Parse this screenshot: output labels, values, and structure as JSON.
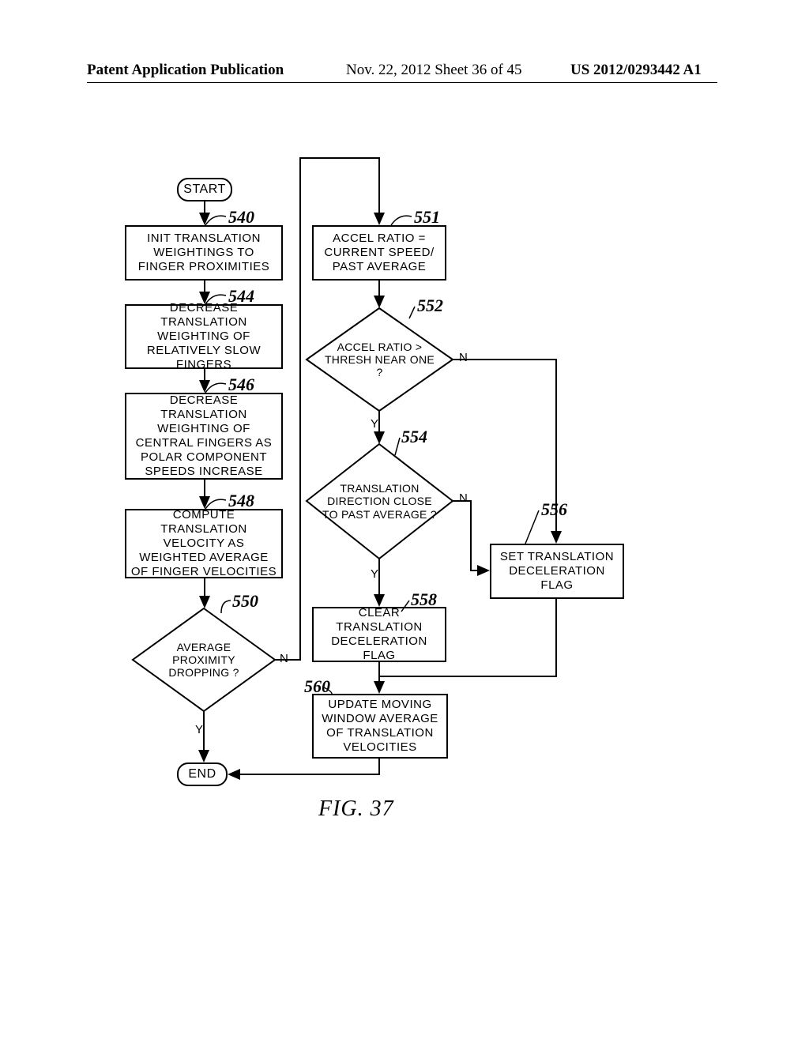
{
  "header": {
    "left": "Patent Application Publication",
    "center": "Nov. 22, 2012  Sheet 36 of 45",
    "right": "US 2012/0293442 A1"
  },
  "figure_label": "FIG.  37",
  "labels": {
    "Y": "Y",
    "N": "N"
  },
  "nodes": {
    "start": "START",
    "b540": "INIT TRANSLATION WEIGHTINGS TO FINGER PROXIMITIES",
    "b544": "DECREASE TRANSLATION WEIGHTING OF RELATIVELY SLOW FINGERS",
    "b546": "DECREASE TRANSLATION WEIGHTING OF CENTRAL FINGERS AS POLAR COMPONENT SPEEDS INCREASE",
    "b548": "COMPUTE TRANSLATION VELOCITY AS WEIGHTED AVERAGE OF FINGER VELOCITIES",
    "d550": "AVERAGE PROXIMITY DROPPING ?",
    "end": "END",
    "b551": "ACCEL RATIO = CURRENT SPEED/ PAST AVERAGE",
    "d552": "ACCEL RATIO > THRESH NEAR ONE ?",
    "d554": "TRANSLATION DIRECTION CLOSE TO PAST AVERAGE ?",
    "b556": "SET TRANSLATION DECELERATION FLAG",
    "b558": "CLEAR TRANSLATION DECELERATION FLAG",
    "b560": "UPDATE MOVING WINDOW AVERAGE OF TRANSLATION VELOCITIES"
  },
  "refs": {
    "r540": "540",
    "r544": "544",
    "r546": "546",
    "r548": "548",
    "r550": "550",
    "r551": "551",
    "r552": "552",
    "r554": "554",
    "r556": "556",
    "r558": "558",
    "r560": "560"
  },
  "chart_data": {
    "type": "flowchart",
    "title": "FIG. 37",
    "nodes": [
      {
        "id": "start",
        "type": "terminal",
        "text": "START"
      },
      {
        "id": "540",
        "type": "process",
        "text": "INIT TRANSLATION WEIGHTINGS TO FINGER PROXIMITIES"
      },
      {
        "id": "544",
        "type": "process",
        "text": "DECREASE TRANSLATION WEIGHTING OF RELATIVELY SLOW FINGERS"
      },
      {
        "id": "546",
        "type": "process",
        "text": "DECREASE TRANSLATION WEIGHTING OF CENTRAL FINGERS AS POLAR COMPONENT SPEEDS INCREASE"
      },
      {
        "id": "548",
        "type": "process",
        "text": "COMPUTE TRANSLATION VELOCITY AS WEIGHTED AVERAGE OF FINGER VELOCITIES"
      },
      {
        "id": "550",
        "type": "decision",
        "text": "AVERAGE PROXIMITY DROPPING ?"
      },
      {
        "id": "end",
        "type": "terminal",
        "text": "END"
      },
      {
        "id": "551",
        "type": "process",
        "text": "ACCEL RATIO = CURRENT SPEED/ PAST AVERAGE"
      },
      {
        "id": "552",
        "type": "decision",
        "text": "ACCEL RATIO > THRESH NEAR ONE ?"
      },
      {
        "id": "554",
        "type": "decision",
        "text": "TRANSLATION DIRECTION CLOSE TO PAST AVERAGE ?"
      },
      {
        "id": "556",
        "type": "process",
        "text": "SET TRANSLATION DECELERATION FLAG"
      },
      {
        "id": "558",
        "type": "process",
        "text": "CLEAR TRANSLATION DECELERATION FLAG"
      },
      {
        "id": "560",
        "type": "process",
        "text": "UPDATE MOVING WINDOW AVERAGE OF TRANSLATION VELOCITIES"
      }
    ],
    "edges": [
      {
        "from": "start",
        "to": "540"
      },
      {
        "from": "540",
        "to": "544"
      },
      {
        "from": "544",
        "to": "546"
      },
      {
        "from": "546",
        "to": "548"
      },
      {
        "from": "548",
        "to": "550"
      },
      {
        "from": "550",
        "to": "end",
        "label": "Y"
      },
      {
        "from": "550",
        "to": "551",
        "label": "N"
      },
      {
        "from": "551",
        "to": "552"
      },
      {
        "from": "552",
        "to": "554",
        "label": "Y"
      },
      {
        "from": "552",
        "to": "556",
        "label": "N"
      },
      {
        "from": "554",
        "to": "558",
        "label": "Y"
      },
      {
        "from": "554",
        "to": "556",
        "label": "N"
      },
      {
        "from": "556",
        "to": "560"
      },
      {
        "from": "558",
        "to": "560"
      },
      {
        "from": "560",
        "to": "end"
      }
    ]
  }
}
